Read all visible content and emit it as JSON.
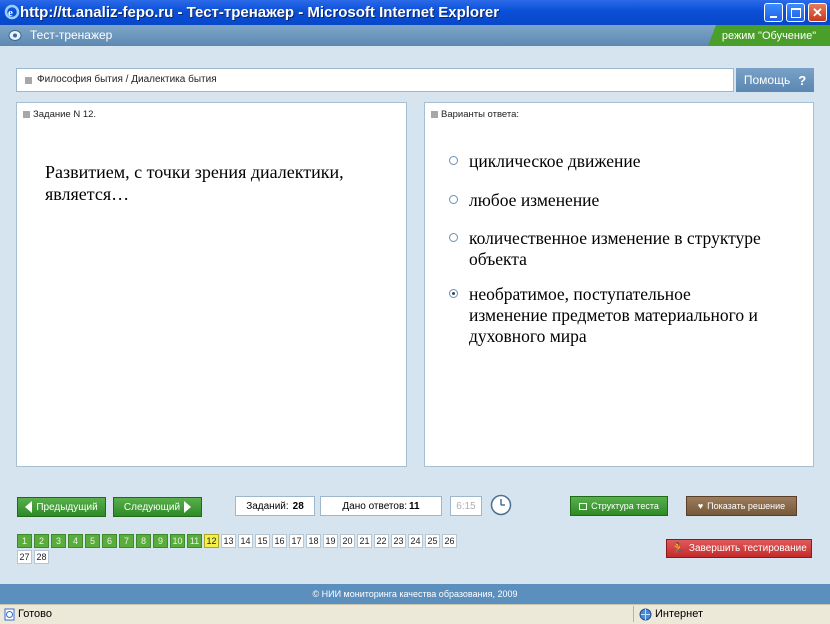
{
  "window": {
    "title": "http://tt.analiz-fepo.ru - Тест-тренажер - Microsoft Internet Explorer"
  },
  "app": {
    "title": "Тест-тренажер",
    "mode": "режим \"Обучение\""
  },
  "breadcrumb": "Философия бытия / Диалектика бытия",
  "help_label": "Помощь",
  "question": {
    "header": "Задание N 12.",
    "text": "Развитием, с точки зрения диалектики, является…"
  },
  "answers": {
    "header": "Варианты ответа:",
    "options": [
      {
        "label": "циклическое движение",
        "selected": false
      },
      {
        "label": "любое изменение",
        "selected": false
      },
      {
        "label": "количественное изменение в структуре объекта",
        "selected": false
      },
      {
        "label": "необратимое, поступательное изменение предметов материального и духовного мира",
        "selected": true
      }
    ]
  },
  "controls": {
    "prev": "Предыдущий",
    "next": "Следующий",
    "tasks_label": "Заданий:",
    "tasks_count": "28",
    "answers_label": "Дано ответов:",
    "answers_count": "11",
    "time": "6:15",
    "structure": "Структура теста",
    "show_solution": "Показать решение",
    "finish": "Завершить тестирование"
  },
  "task_numbers": [
    "1",
    "2",
    "3",
    "4",
    "5",
    "6",
    "7",
    "8",
    "9",
    "10",
    "11",
    "12",
    "13",
    "14",
    "15",
    "16",
    "17",
    "18",
    "19",
    "20",
    "21",
    "22",
    "23",
    "24",
    "25",
    "26",
    "27",
    "28"
  ],
  "answered_count": 11,
  "current_task": "12",
  "footer": "© НИИ мониторинга качества образования, 2009",
  "statusbar": {
    "left": "Готово",
    "zone": "Интернет"
  },
  "colors": {
    "accent_green": "#3f9a34",
    "current_task": "#f3f04a",
    "finish_red": "#d83a3a",
    "brown_button": "#8a6a4a"
  }
}
